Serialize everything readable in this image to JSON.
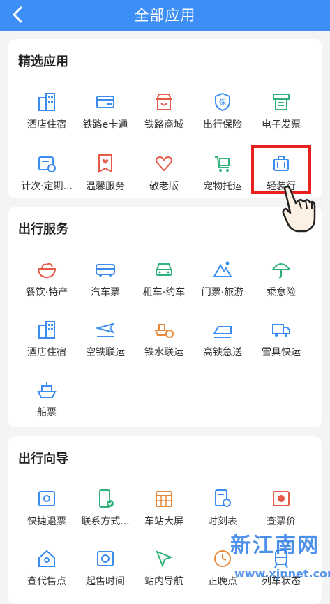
{
  "header": {
    "title": "全部应用"
  },
  "sections": [
    {
      "title": "精选应用",
      "items": [
        {
          "label": "酒店住宿",
          "icon": "hotel-icon"
        },
        {
          "label": "铁路e卡通",
          "icon": "card-icon"
        },
        {
          "label": "铁路商城",
          "icon": "shop-icon"
        },
        {
          "label": "出行保险",
          "icon": "insurance-icon"
        },
        {
          "label": "电子发票",
          "icon": "invoice-icon"
        },
        {
          "label": "计次·定期...",
          "icon": "calendar-ticket-icon"
        },
        {
          "label": "温馨服务",
          "icon": "heart-bookmark-icon"
        },
        {
          "label": "敬老版",
          "icon": "heart-icon"
        },
        {
          "label": "宠物托运",
          "icon": "pet-cart-icon"
        },
        {
          "label": "轻装行",
          "icon": "luggage-icon"
        }
      ]
    },
    {
      "title": "出行服务",
      "items": [
        {
          "label": "餐饮·特产",
          "icon": "noodle-icon"
        },
        {
          "label": "汽车票",
          "icon": "bus-icon"
        },
        {
          "label": "租车·约车",
          "icon": "car-icon"
        },
        {
          "label": "门票·旅游",
          "icon": "mountain-icon"
        },
        {
          "label": "乘意险",
          "icon": "umbrella-icon"
        },
        {
          "label": "酒店住宿",
          "icon": "hotel-icon"
        },
        {
          "label": "空铁联运",
          "icon": "plane-icon"
        },
        {
          "label": "铁水联运",
          "icon": "ship-rail-icon"
        },
        {
          "label": "高铁急送",
          "icon": "bullet-train-icon"
        },
        {
          "label": "雪具快运",
          "icon": "truck-icon"
        },
        {
          "label": "船票",
          "icon": "ship-icon"
        }
      ]
    },
    {
      "title": "出行向导",
      "items": [
        {
          "label": "快捷退票",
          "icon": "refund-ticket-icon"
        },
        {
          "label": "联系方式...",
          "icon": "phone-check-icon"
        },
        {
          "label": "车站大屏",
          "icon": "grid-screen-icon"
        },
        {
          "label": "时刻表",
          "icon": "timetable-icon"
        },
        {
          "label": "查票价",
          "icon": "price-icon"
        },
        {
          "label": "查代售点",
          "icon": "house-icon"
        },
        {
          "label": "起售时间",
          "icon": "clock-ticket-icon"
        },
        {
          "label": "站内导航",
          "icon": "navigation-icon"
        },
        {
          "label": "正晚点",
          "icon": "clock-icon"
        },
        {
          "label": "列车状态",
          "icon": "train-icon"
        }
      ]
    }
  ],
  "watermark": {
    "text": "新江南网",
    "url": "www.xjnnet.com"
  },
  "colors": {
    "header": "#3d8ff5",
    "icon_blue": "#3b8cf0",
    "icon_red": "#e65a4a",
    "icon_green": "#2fb27a",
    "highlight": "#e8211c"
  }
}
